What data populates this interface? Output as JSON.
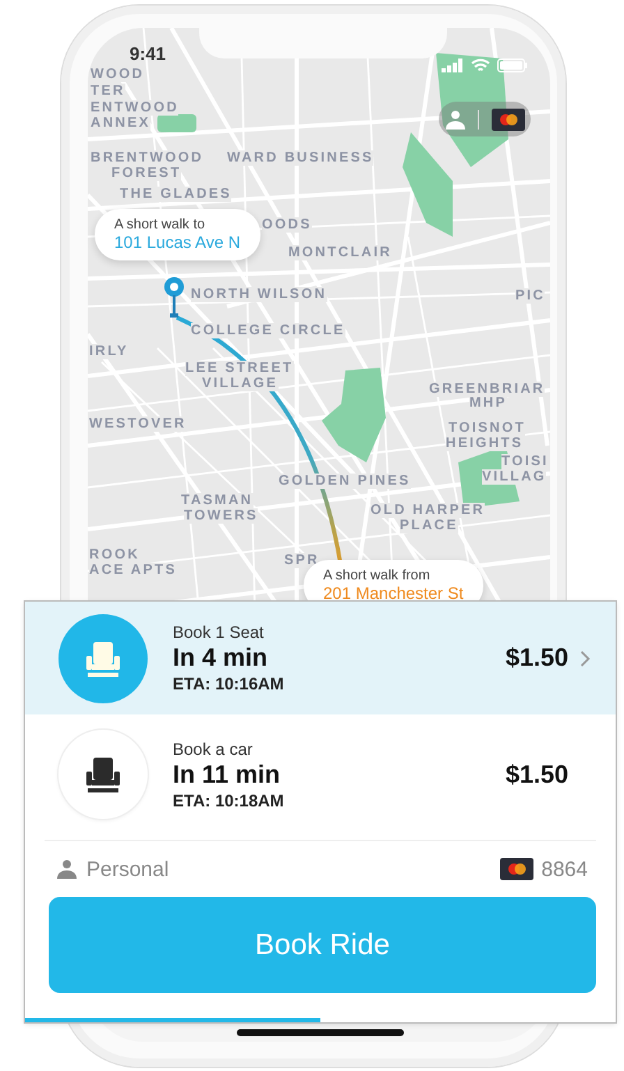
{
  "status_bar": {
    "time": "9:41"
  },
  "map": {
    "labels": [
      "WOOD",
      "TER",
      "ENTWOOD",
      "ANNEX",
      "BRENTWOOD",
      "FOREST",
      "THE GLADES",
      "WARD BUSINESS",
      "OODS",
      "MONTCLAIR",
      "NORTH WILSON",
      "PIC",
      "IRLY",
      "COLLEGE CIRCLE",
      "LEE STREET",
      "VILLAGE",
      "GREENBRIAR",
      "MHP",
      "WESTOVER",
      "TOISNOT",
      "HEIGHTS",
      "TOISI",
      "VILLAG",
      "GOLDEN PINES",
      "TASMAN",
      "TOWERS",
      "OLD HARPER",
      "PLACE",
      "ROOK",
      "ACE APTS",
      "SPR"
    ]
  },
  "callouts": [
    {
      "kind": "pickup",
      "caption": "A short walk to",
      "address": "101 Lucas Ave N"
    },
    {
      "kind": "dropoff",
      "caption": "A short walk from",
      "address": "201 Manchester St"
    }
  ],
  "options": [
    {
      "title": "Book 1 Seat",
      "wait": "In 4 min",
      "eta": "ETA: 10:16AM",
      "price": "$1.50",
      "selected": true
    },
    {
      "title": "Book a car",
      "wait": "In 11 min",
      "eta": "ETA: 10:18AM",
      "price": "$1.50",
      "selected": false
    }
  ],
  "account": {
    "profile": "Personal",
    "card": "8864"
  },
  "book_button": "Book Ride",
  "progress": {
    "level": 0.5
  }
}
